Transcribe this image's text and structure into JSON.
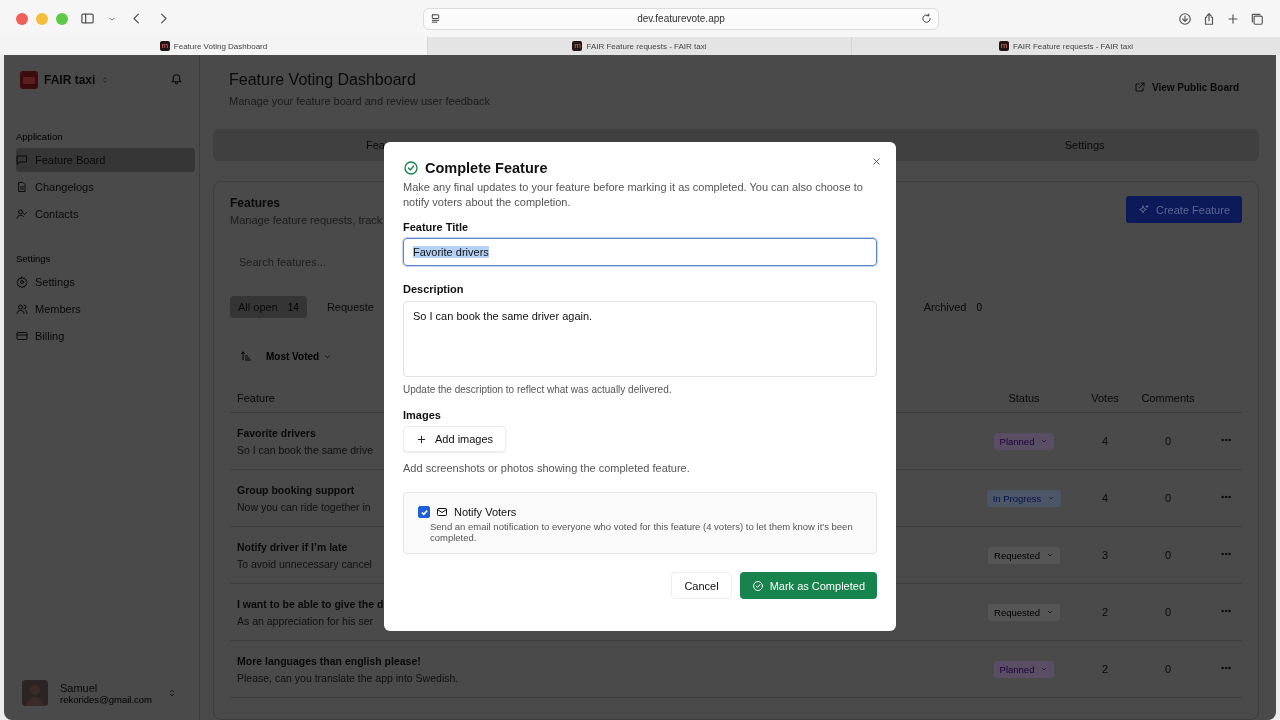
{
  "browser": {
    "url": "dev.featurevote.app",
    "tabs": [
      {
        "title": "Feature Voting Dashboard",
        "icon_letter": "m",
        "selected": true
      },
      {
        "title": "FAIR Feature requests - FAIR taxi",
        "icon_letter": "m",
        "selected": false
      },
      {
        "title": "FAIR Feature requests - FAIR taxi",
        "icon_letter": "m",
        "selected": false
      }
    ]
  },
  "sidebar": {
    "workspace": "FAIR taxi",
    "sections": [
      {
        "heading": "Application",
        "items": [
          {
            "label": "Feature Board",
            "selected": true
          },
          {
            "label": "Changelogs",
            "selected": false
          },
          {
            "label": "Contacts",
            "selected": false
          }
        ]
      },
      {
        "heading": "Settings",
        "items": [
          {
            "label": "Settings",
            "selected": false
          },
          {
            "label": "Members",
            "selected": false
          },
          {
            "label": "Billing",
            "selected": false
          }
        ]
      }
    ],
    "user": {
      "name": "Samuel",
      "email": "rekorides@gmail.com"
    }
  },
  "header": {
    "title": "Feature Voting Dashboard",
    "subtitle": "Manage your feature board and review user feedback",
    "link": "View Public Board"
  },
  "board_tabs": [
    "Fea",
    "Settings"
  ],
  "features": {
    "title": "Features",
    "subtitle": "Manage feature requests, track",
    "create_button": "Create Feature",
    "search_placeholder": "Search features...",
    "filters": [
      {
        "label": "All open",
        "count": "14",
        "selected": true
      },
      {
        "label": "Requeste",
        "selected": false
      },
      {
        "label": "Archived",
        "count": "0",
        "selected": false
      }
    ],
    "sort": "Most Voted",
    "columns": [
      "Feature",
      "Status",
      "Votes",
      "Comments"
    ],
    "rows": [
      {
        "title": "Favorite drivers",
        "description": "So I can book the same drive",
        "status": {
          "label": "Planned",
          "kind": "planned"
        },
        "votes": "4",
        "comments": "0"
      },
      {
        "title": "Group booking support",
        "description": "Now you can ride together in",
        "status": {
          "label": "In Progress",
          "kind": "in_progress"
        },
        "votes": "4",
        "comments": "0"
      },
      {
        "title": "Notify driver if I’m late",
        "description": "To avoid unnecessary cancel",
        "status": {
          "label": "Requested",
          "kind": "requested"
        },
        "votes": "3",
        "comments": "0"
      },
      {
        "title": "I want to be able to give the d",
        "description": "As an appreciation for his ser",
        "status": {
          "label": "Requested",
          "kind": "requested"
        },
        "votes": "2",
        "comments": "0"
      },
      {
        "title": "More languages than english please!",
        "description": "Please, can you translate the app into Swedish.",
        "status": {
          "label": "Planned",
          "kind": "planned"
        },
        "votes": "2",
        "comments": "0"
      }
    ]
  },
  "dialog": {
    "title": "Complete Feature",
    "intro": "Make any final updates to your feature before marking it as completed. You can also choose to notify voters about the completion.",
    "title_label": "Feature Title",
    "title_value": "Favorite drivers",
    "title_value_selected": true,
    "description_label": "Description",
    "description_value": "So I can book the same driver again.",
    "description_hint": "Update the description to reflect what was actually delivered.",
    "images_label": "Images",
    "add_images": "Add images",
    "images_hint": "Add screenshots or photos showing the completed feature.",
    "notify": {
      "label": "Notify Voters",
      "text": "Send an email notification to everyone who voted for this feature (4 voters) to let them know it's been completed.",
      "checked": true
    },
    "cancel": "Cancel",
    "confirm": "Mark as Completed"
  }
}
